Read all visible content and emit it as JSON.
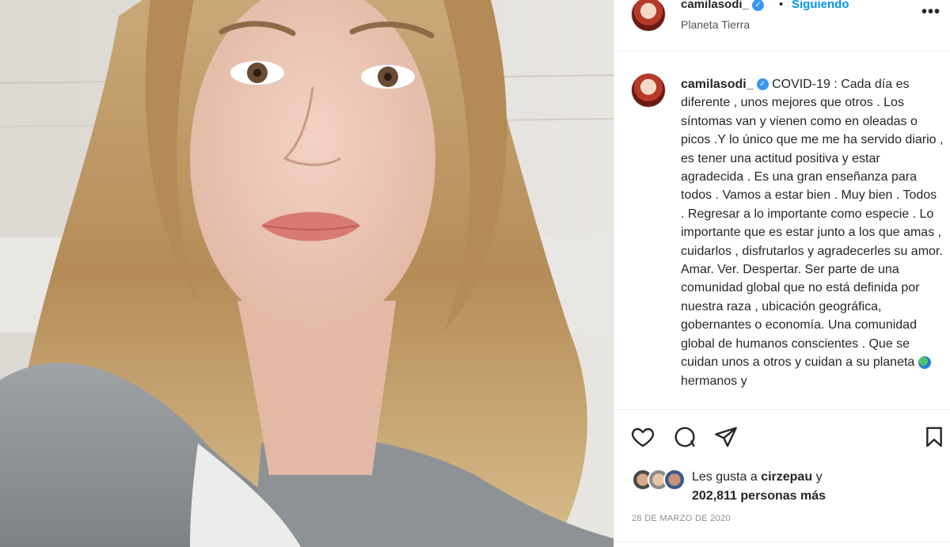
{
  "post": {
    "username": "camilasodi_",
    "follow_status": "Siguiendo",
    "location": "Planeta Tierra",
    "more_label": "•••",
    "separator": "•",
    "verified_glyph": "✓"
  },
  "caption": {
    "username": "camilasodi_",
    "text_part1": "COVID-19 : Cada día es diferente , unos mejores que otros . Los síntomas van y vienen como en oleadas o picos .Y lo único que me me ha servido diario , es tener una actitud positiva y estar agradecida . Es una gran enseñanza para todos . Vamos a estar bien . Muy bien . Todos . Regresar a lo importante como especie . Lo importante que es estar junto a los que amas , cuidarlos , disfrutarlos y agradecerles su amor. Amar. Ver. Despertar. Ser parte de una comunidad global que no está definida por nuestra raza , ubicación geográfica, gobernantes o economía. Una comunidad global de humanos conscientes . Que se cuidan unos a otros y cuidan a su planeta",
    "text_part2": "hermanos y",
    "emoji": "globe-emoji"
  },
  "actions": {
    "like_icon": "heart-icon",
    "comment_icon": "comment-icon",
    "share_icon": "send-icon",
    "save_icon": "bookmark-icon"
  },
  "likes": {
    "prefix": "Les gusta a",
    "user": "cirzepau",
    "connector": "y",
    "count_text": "202,811 personas más"
  },
  "date": "28 DE MARZO DE 2020",
  "colors": {
    "accent": "#0095f6",
    "verified": "#3897f0",
    "text": "#262626",
    "muted": "#8e8e8e"
  }
}
